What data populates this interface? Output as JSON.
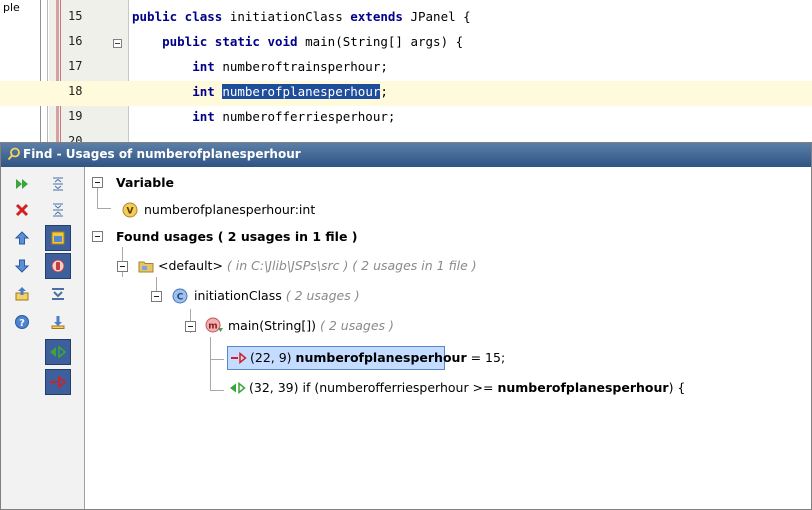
{
  "editor": {
    "left_fragment": "ple",
    "lines": [
      {
        "num": "15",
        "parts": [
          {
            "t": "public class",
            "kw": true
          },
          {
            "t": " initiationClass "
          },
          {
            "t": "extends",
            "kw": true
          },
          {
            "t": " JPanel {"
          }
        ]
      },
      {
        "num": "16",
        "parts": [
          {
            "t": "    "
          },
          {
            "t": "public static void",
            "kw": true
          },
          {
            "t": " main(String[] args) {"
          }
        ]
      },
      {
        "num": "17",
        "parts": [
          {
            "t": "        "
          },
          {
            "t": "int",
            "kw": true
          },
          {
            "t": " numberoftrainsperhour;"
          }
        ]
      },
      {
        "num": "18",
        "parts": [
          {
            "t": "        "
          },
          {
            "t": "int",
            "kw": true
          },
          {
            "t": " "
          },
          {
            "t": "numberofplanesperhour",
            "sel": true
          },
          {
            "t": ";"
          }
        ]
      },
      {
        "num": "19",
        "parts": [
          {
            "t": "        "
          },
          {
            "t": "int",
            "kw": true
          },
          {
            "t": " numberofferriesperhour;"
          }
        ]
      },
      {
        "num": "20",
        "parts": []
      }
    ]
  },
  "panel": {
    "title": "Find - Usages of numberofplanesperhour",
    "tree": {
      "variable_header": "Variable",
      "variable_item": "numberofplanesperhour:int",
      "found_header": "Found usages ( 2 usages in 1 file )",
      "package_label": "<default>",
      "package_meta": "( in C:\\Jlib\\JSPs\\src ) ( 2 usages in 1 file )",
      "class_label": "initiationClass",
      "class_meta": "( 2 usages )",
      "method_label": "main(String[])",
      "method_meta": "( 2 usages )",
      "usage1": {
        "pos": "(22, 9)",
        "name": "numberofplanesperhour",
        "rest": " = 15;"
      },
      "usage2": {
        "pos": "(32, 39)",
        "pre": " if (numberofferriesperhour >= ",
        "name": "numberofplanesperhour",
        "post": ") {"
      }
    }
  },
  "colors": {
    "title_bar_top": "#5c7fa8",
    "title_bar_bottom": "#2f5483",
    "selection": "#1e4d9b",
    "current_line": "#fffadc",
    "selected_row": "#c4dcff"
  }
}
